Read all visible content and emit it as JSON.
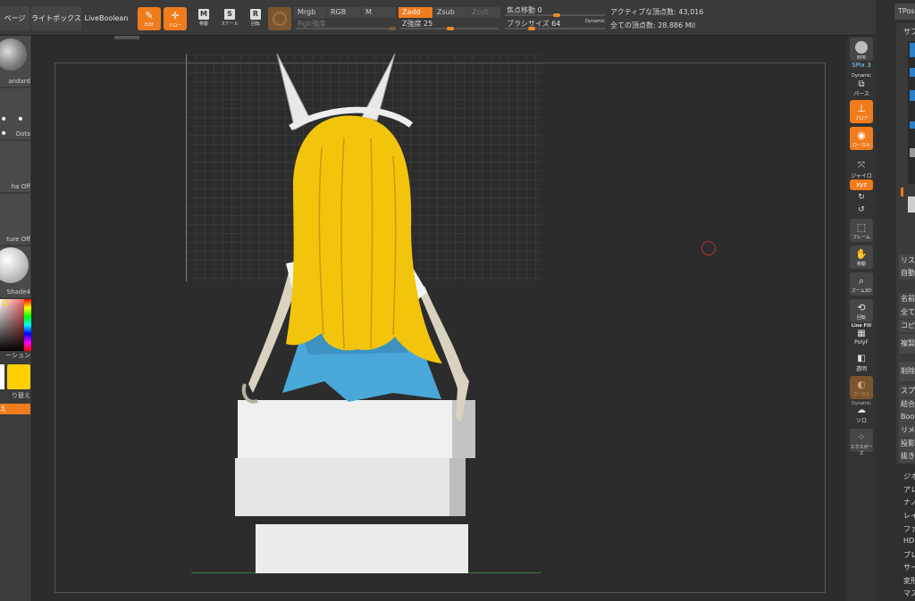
{
  "topbar": {
    "homepage_label": "ページ",
    "lightbox_label": "ライトボックス",
    "liveboolean_label": "LiveBoolean",
    "edit_label": "Edit",
    "draw_label": "ドロー",
    "move_label": "移動",
    "scale_label": "スケール",
    "rotate_label": "回転",
    "move_key": "M",
    "scale_key": "S",
    "rotate_key": "R",
    "mrgb_label": "Mrgb",
    "rgb_label": "RGB",
    "m_label": "M",
    "rgb_intensity_label": "Rgb強度",
    "zadd_label": "Zadd",
    "zsub_label": "Zsub",
    "zcut_label": "Zcut",
    "z_intensity_label": "Z強度",
    "z_intensity_value": "25",
    "focal_shift_label": "焦点移動",
    "focal_shift_value": "0",
    "brush_size_label": "ブラシサイズ",
    "brush_size_value": "64",
    "dynamic_label": "Dynamic",
    "active_points": "アクティブな頂点数: 43,016",
    "total_points": "全ての頂点数: 28.886 Mil"
  },
  "leftshelf": {
    "brush_label": "andard",
    "stroke_label": "Dots",
    "alpha_label": "ha Off",
    "texture_label": "ture Off",
    "material_label": "Shade4",
    "gradient_label": "ーション",
    "switch_label": "り替え",
    "swap_label": "え"
  },
  "rightcol": {
    "bpr_label": "BPR",
    "spix_label": "SPix",
    "spix_value": "3",
    "dynamic_label": "Dynamic",
    "persp_label": "パース",
    "floor_label": "フロア",
    "local_label": "ローカル",
    "gyro_label": "ジャイロ",
    "xyz_label": "xyz",
    "frame_label": "フレーム",
    "move_label": "移動",
    "zoom_label": "ズーム3D",
    "rotate_label": "回転",
    "linefill_label": "Line Fill",
    "polyf_label": "PolyF",
    "transp_label": "透明",
    "ghost_label": "ゴースト",
    "dynamic2_label": "Dynamic",
    "solo_label": "ソロ",
    "xpose_label": "エクスポーズ"
  },
  "farright": {
    "tpose_label": "TPos",
    "subtool_label": "サブ",
    "list_label": "リス",
    "auto_label": "自動",
    "name_label": "名前",
    "all_label": "全て",
    "copy_label": "コピ",
    "dup_label": "複製",
    "del_label": "削除",
    "split_label": "スプ",
    "merge_label": "結合",
    "bool_label": "Bool",
    "remesh_label": "リメ",
    "project_label": "投影",
    "extract_label": "抜き",
    "geometry_label": "ジオ",
    "array_label": "アレ",
    "nano_label": "ナノ",
    "layer_label": "レイ",
    "fiber_label": "ファ",
    "hd_label": "HD",
    "preview_label": "プレ",
    "surface_label": "サー",
    "deform_label": "変形",
    "mask_label": "マス"
  },
  "colors": {
    "accent_orange": "#f07c1d",
    "hair_yellow": "#f2c40c",
    "skirt_blue": "#4aa8d8",
    "active_color": "#ffd000"
  }
}
